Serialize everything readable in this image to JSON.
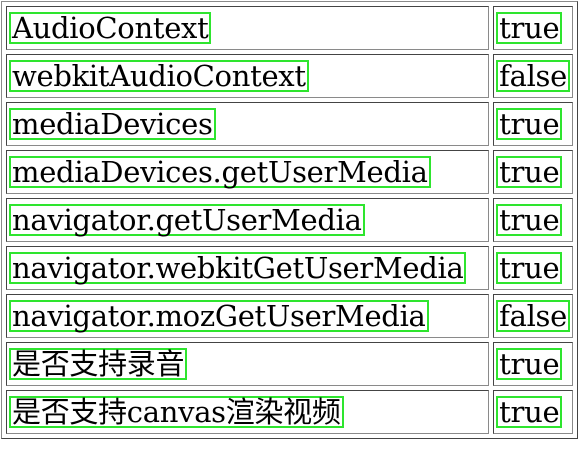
{
  "rows": [
    {
      "name": "AudioContext",
      "value": "true"
    },
    {
      "name": "webkitAudioContext",
      "value": "false"
    },
    {
      "name": "mediaDevices",
      "value": "true"
    },
    {
      "name": "mediaDevices.getUserMedia",
      "value": "true"
    },
    {
      "name": "navigator.getUserMedia",
      "value": "true"
    },
    {
      "name": "navigator.webkitGetUserMedia",
      "value": "true"
    },
    {
      "name": "navigator.mozGetUserMedia",
      "value": "false"
    },
    {
      "name": "是否支持录音",
      "value": "true"
    },
    {
      "name": "是否支持canvas渲染视频",
      "value": "true"
    }
  ],
  "colors": {
    "highlight_border": "#2ee52e",
    "cell_border_dark": "#444444",
    "cell_border_light": "#8a8a8a"
  }
}
